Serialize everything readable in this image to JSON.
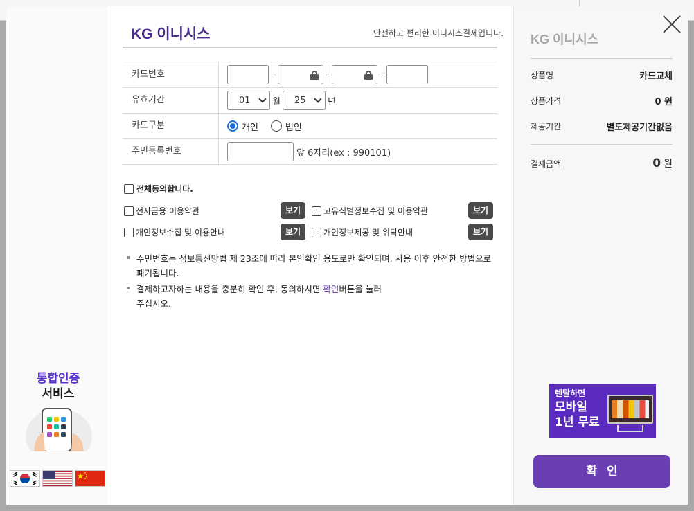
{
  "header": {
    "brand": "KG 이니시스",
    "tagline": "안전하고 편리한 이니시스결제입니다."
  },
  "form": {
    "card_number_label": "카드번호",
    "expiry_label": "유효기간",
    "expiry_month": "01",
    "month_unit": "월",
    "expiry_year": "25",
    "year_unit": "년",
    "card_type_label": "카드구분",
    "card_type_personal": "개인",
    "card_type_corporate": "법인",
    "resident_label": "주민등록번호",
    "resident_hint": "앞 6자리(ex : 990101)",
    "separator": "-"
  },
  "agreements": {
    "agree_all": "전체동의합니다.",
    "items": [
      "전자금융 이용약관",
      "고유식별정보수집 및 이용약관",
      "개인정보수집 및 이용안내",
      "개인정보제공 및 위탁안내"
    ],
    "view_label": "보기"
  },
  "notes": {
    "note1": "주민번호는 정보통신망법 제 23조에 따라 본인확인 용도로만 확인되며, 사용 이후 안전한 방법으로 폐기됩니다.",
    "note2_pre": "결제하고자하는 내용을 충분히 확인 후, 동의하시면 ",
    "note2_highlight": "확인",
    "note2_post": "버튼을 눌러",
    "note2_line2": "주십시오."
  },
  "summary": {
    "brand": "KG 이니시스",
    "product_label": "상품명",
    "product_value": "카드교체",
    "price_label": "상품가격",
    "price_value": "0 원",
    "period_label": "제공기간",
    "period_value": "별도제공기간없음",
    "total_label": "결제금액",
    "total_value": "0",
    "total_unit": "원"
  },
  "promo": {
    "auth_line1": "통합인증",
    "auth_line2": "서비스",
    "ad_line1": "렌탈하면",
    "ad_line2": "모바일",
    "ad_line3": "1년 무료"
  },
  "confirm_label": "확인",
  "colors": {
    "brand_purple": "#6a3fb5",
    "radio_blue": "#1a6fe0",
    "button_dark": "#4a4a4a"
  }
}
